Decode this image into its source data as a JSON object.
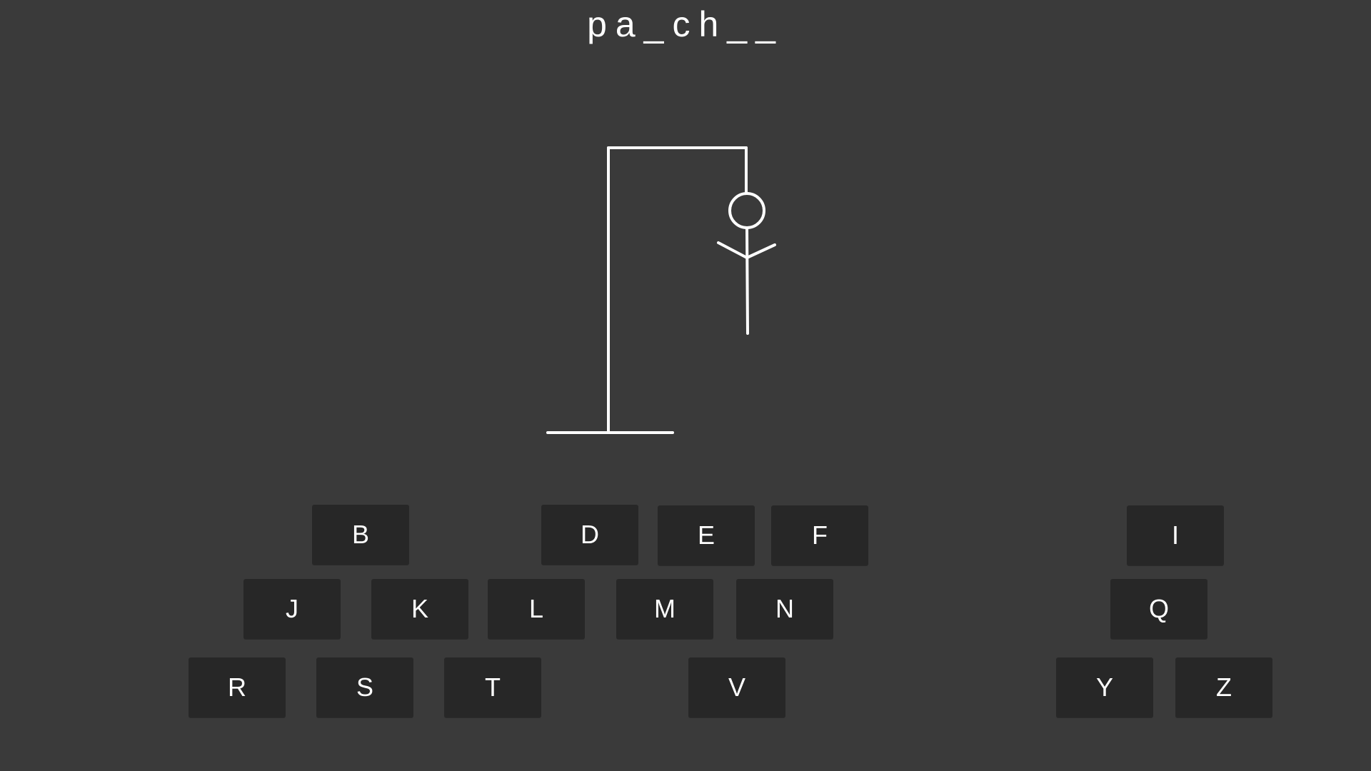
{
  "game": {
    "word_display": "pa_ch__",
    "wrong_guesses": 4
  },
  "keyboard": {
    "keys": [
      "B",
      "D",
      "E",
      "F",
      "I",
      "J",
      "K",
      "L",
      "M",
      "N",
      "Q",
      "R",
      "S",
      "T",
      "V",
      "Y",
      "Z"
    ]
  },
  "colors": {
    "background": "#3a3a3a",
    "key_background": "#272727",
    "foreground": "#ffffff"
  }
}
